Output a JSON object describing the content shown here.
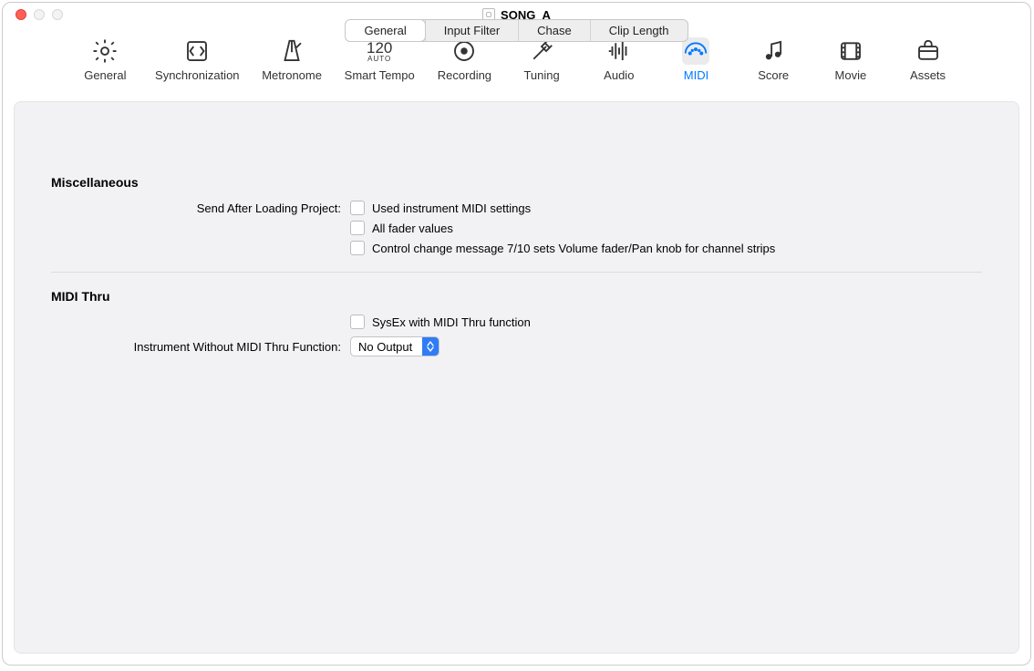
{
  "window": {
    "title": "SONG_A"
  },
  "toolbar": {
    "items": [
      {
        "key": "general",
        "label": "General",
        "icon": "gear-icon"
      },
      {
        "key": "sync",
        "label": "Synchronization",
        "icon": "sync-icon"
      },
      {
        "key": "metronome",
        "label": "Metronome",
        "icon": "metronome-icon"
      },
      {
        "key": "smarttempo",
        "label": "Smart Tempo",
        "icon": "smart-tempo-icon",
        "top": "120",
        "sub": "AUTO"
      },
      {
        "key": "recording",
        "label": "Recording",
        "icon": "record-icon"
      },
      {
        "key": "tuning",
        "label": "Tuning",
        "icon": "tuning-icon"
      },
      {
        "key": "audio",
        "label": "Audio",
        "icon": "audio-icon"
      },
      {
        "key": "midi",
        "label": "MIDI",
        "icon": "midi-icon",
        "active": true
      },
      {
        "key": "score",
        "label": "Score",
        "icon": "score-icon"
      },
      {
        "key": "movie",
        "label": "Movie",
        "icon": "movie-icon"
      },
      {
        "key": "assets",
        "label": "Assets",
        "icon": "assets-icon"
      }
    ]
  },
  "tabs": {
    "items": [
      {
        "label": "General",
        "selected": true
      },
      {
        "label": "Input Filter"
      },
      {
        "label": "Chase"
      },
      {
        "label": "Clip Length"
      }
    ]
  },
  "misc": {
    "header": "Miscellaneous",
    "send_label": "Send After Loading Project:",
    "opt1": "Used instrument MIDI settings",
    "opt2": "All fader values",
    "opt3": "Control change message 7/10 sets Volume fader/Pan knob for channel strips"
  },
  "midithru": {
    "header": "MIDI Thru",
    "opt1": "SysEx with MIDI Thru function",
    "select_label": "Instrument Without MIDI Thru Function:",
    "select_value": "No Output"
  }
}
